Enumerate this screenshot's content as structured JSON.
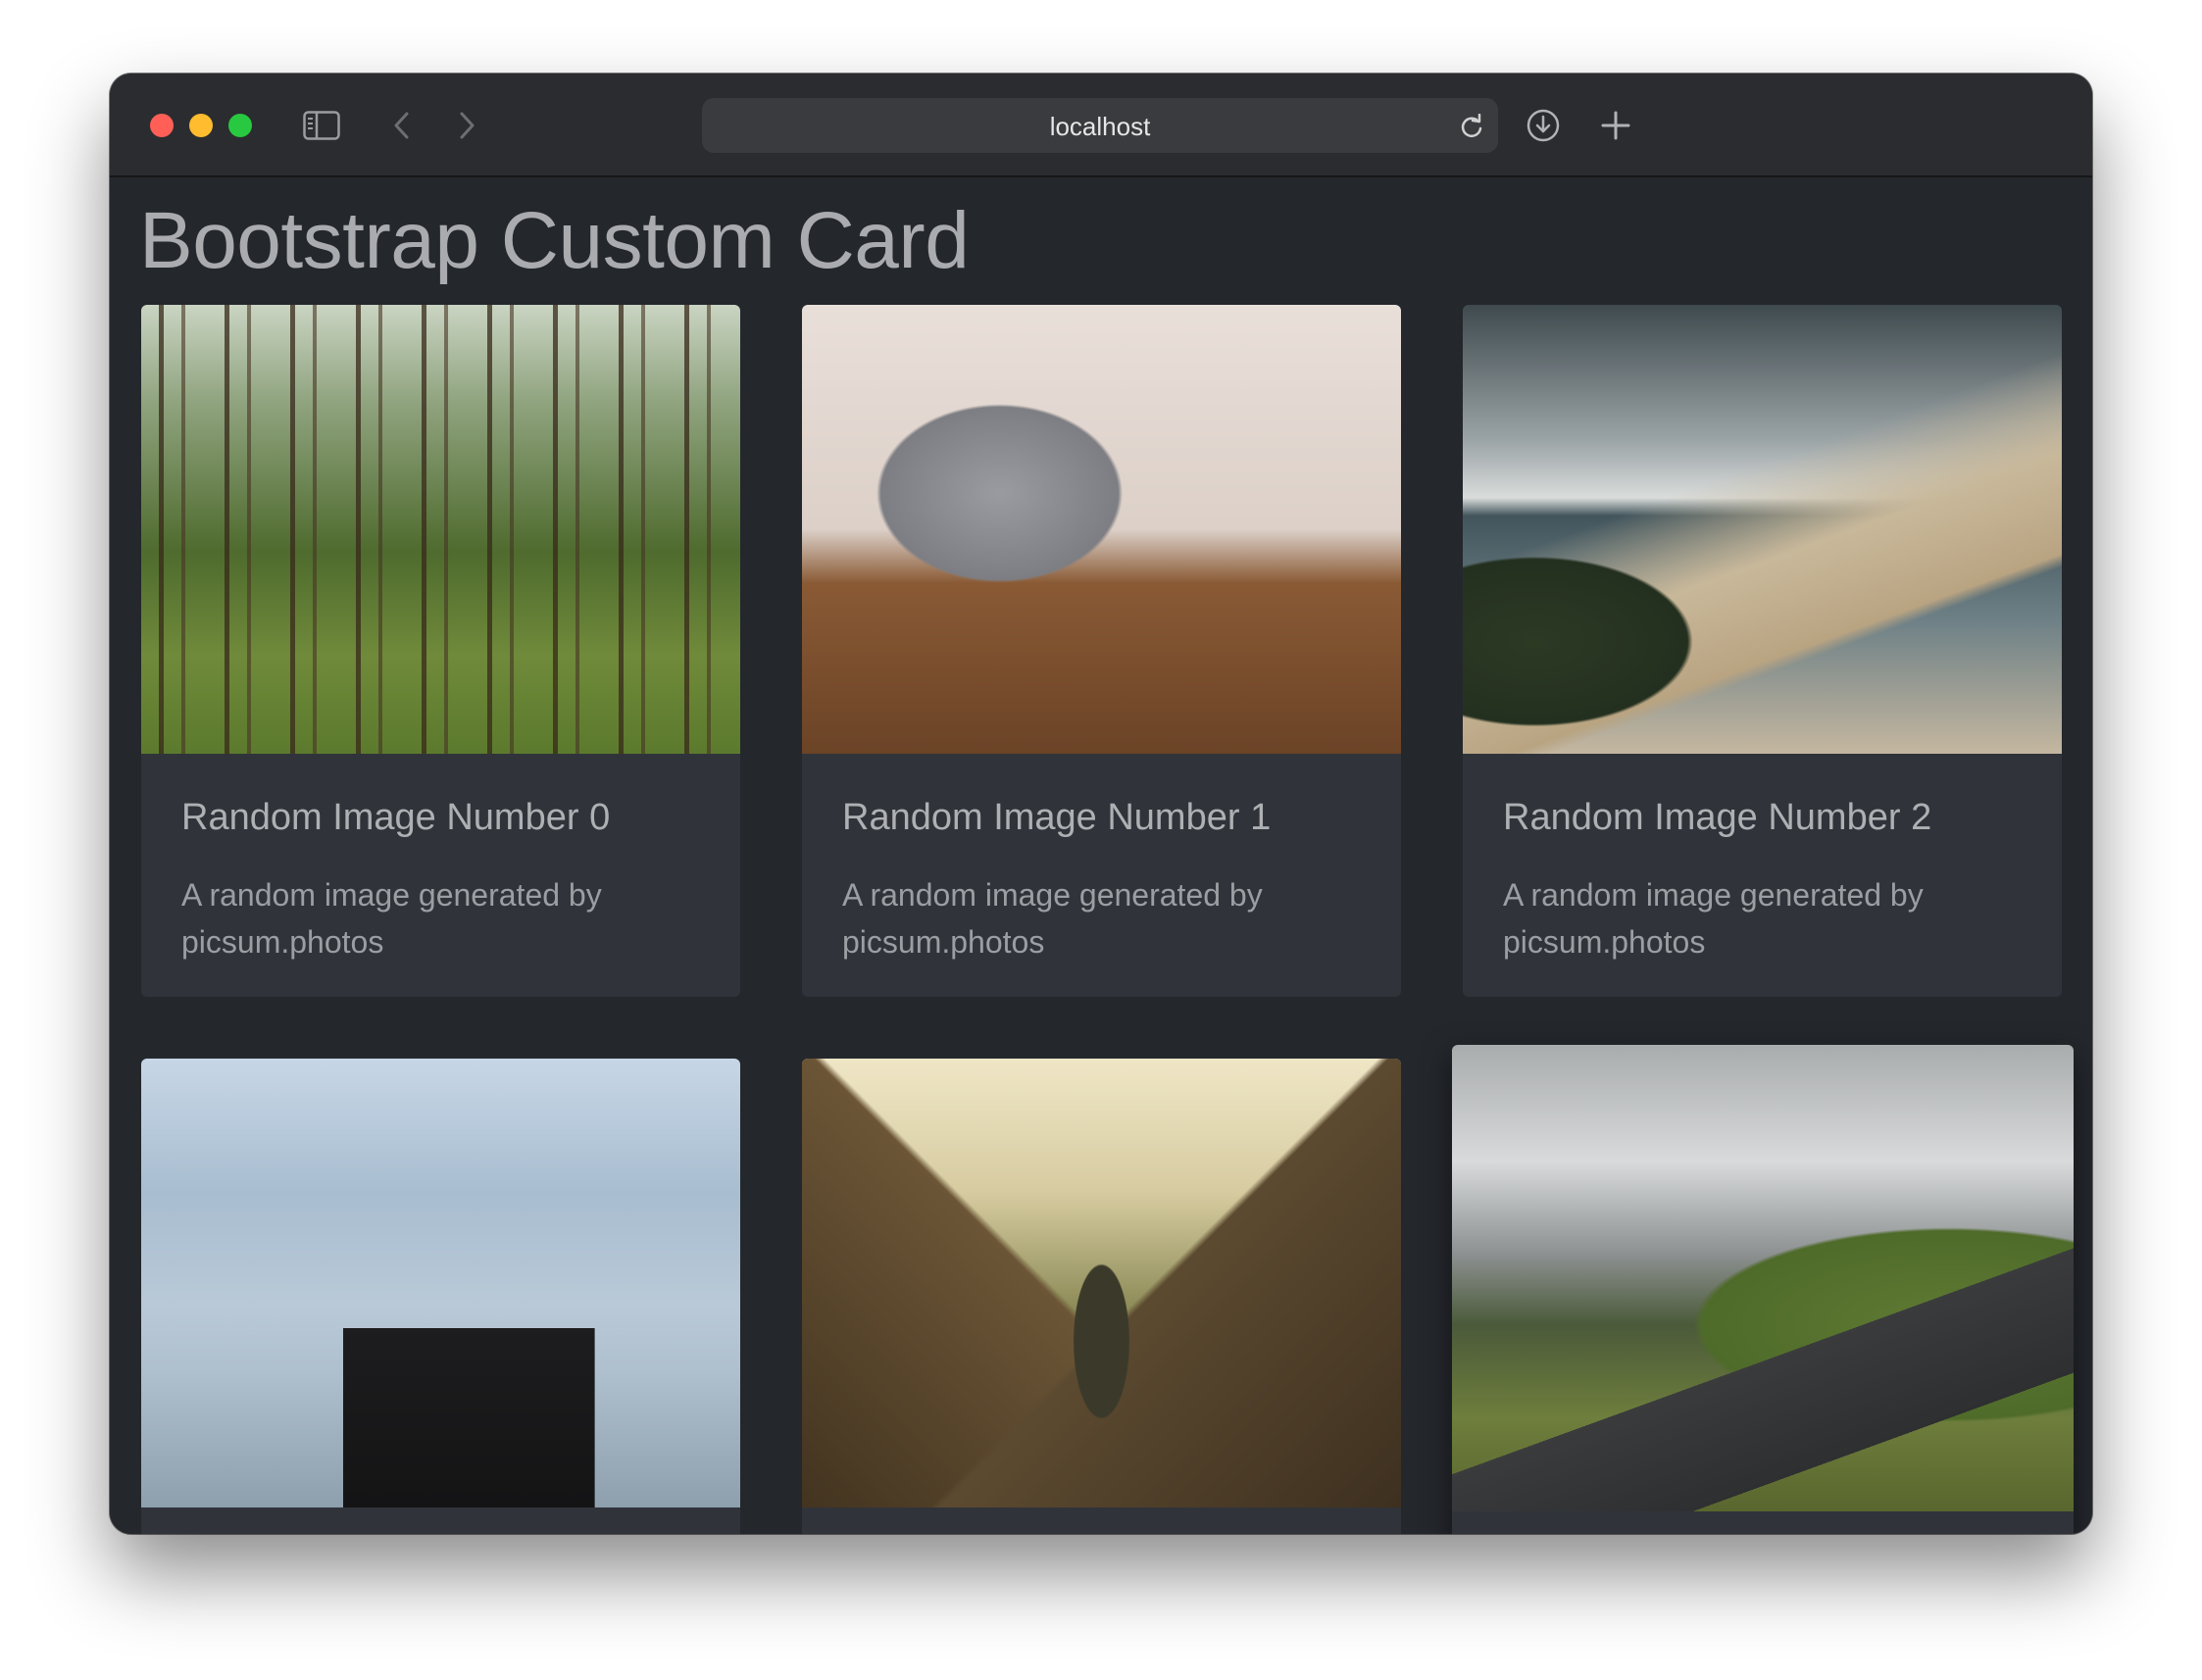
{
  "browser": {
    "url": "localhost",
    "buttons": {
      "sidebar": "sidebar-toggle",
      "back": "back",
      "forward": "forward",
      "reload": "reload",
      "downloads": "downloads",
      "new_tab": "new-tab"
    }
  },
  "page": {
    "title": "Bootstrap Custom Card",
    "cards": [
      {
        "title": "Random Image Number 0",
        "text": "A random image generated by picsum.photos",
        "image": "forest"
      },
      {
        "title": "Random Image Number 1",
        "text": "A random image generated by picsum.photos",
        "image": "laptop"
      },
      {
        "title": "Random Image Number 2",
        "text": "A random image generated by picsum.photos",
        "image": "coast"
      },
      {
        "title": "",
        "text": "",
        "image": "lake-pier"
      },
      {
        "title": "",
        "text": "",
        "image": "mountain-hiker"
      },
      {
        "title": "",
        "text": "",
        "image": "mountain-road"
      }
    ]
  },
  "colors": {
    "page_background": "#24272c",
    "card_background": "#30343a",
    "title_text": "#a9abae",
    "traffic_red": "#ff5f57",
    "traffic_yellow": "#febc2e",
    "traffic_green": "#28c840"
  }
}
